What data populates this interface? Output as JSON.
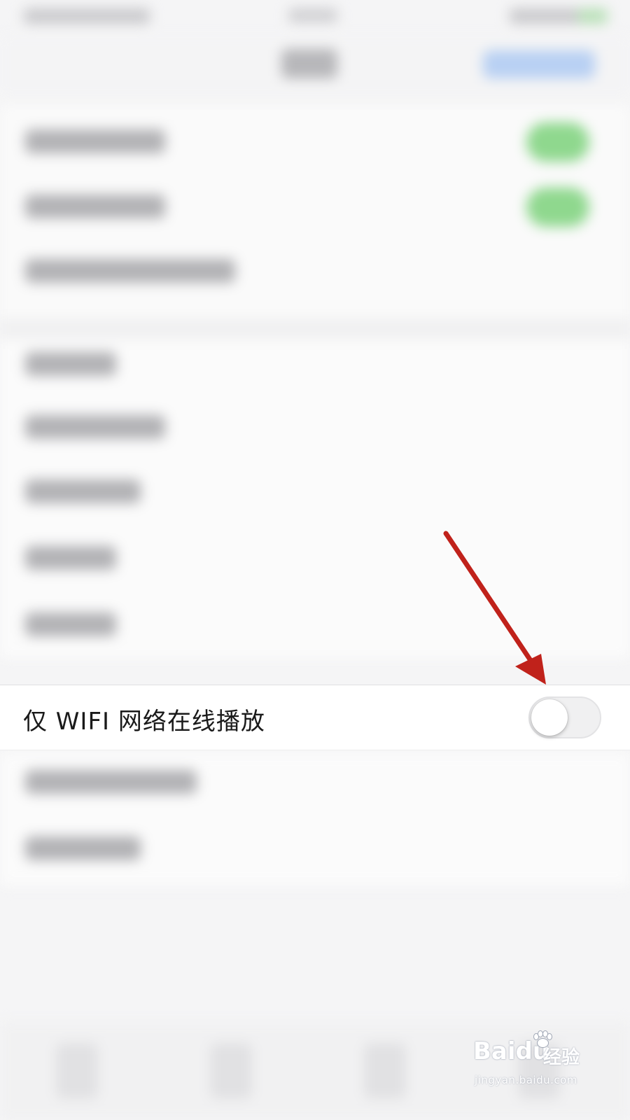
{
  "setting_row": {
    "label": "仅 WIFI 网络在线播放",
    "toggle_state": "off"
  },
  "annotation": {
    "arrow_color": "#c0221b"
  },
  "watermark": {
    "brand": "Baidu",
    "brand_suffix": "经验",
    "url": "jingyan.baidu.com"
  },
  "colors": {
    "background": "#f5f5f6",
    "row_background": "#ffffff",
    "toggle_on_blurred": "#8fd88e",
    "nav_action_blurred": "#b8d0f3"
  }
}
